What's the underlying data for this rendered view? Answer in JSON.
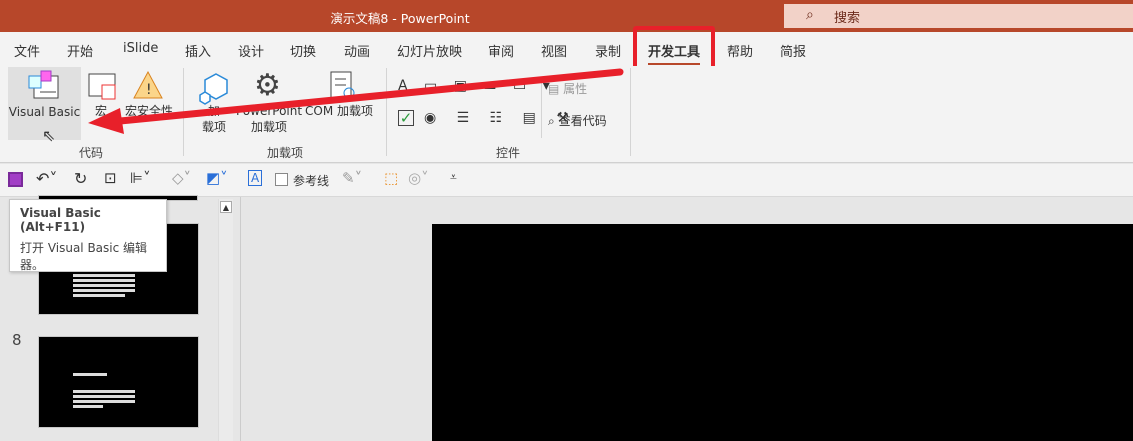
{
  "window": {
    "title": "演示文稿8  -  PowerPoint",
    "search_label": "搜索"
  },
  "tabs": [
    "文件",
    "开始",
    "iSlide",
    "插入",
    "设计",
    "切换",
    "动画",
    "幻灯片放映",
    "审阅",
    "视图",
    "录制",
    "开发工具",
    "帮助",
    "简报"
  ],
  "active_tab": "开发工具",
  "ribbon": {
    "code_group": {
      "label": "代码",
      "visual_basic": "Visual Basic",
      "macros": "宏",
      "macro_security": "宏安全性"
    },
    "addins_group": {
      "label": "加载项",
      "addins_1": "加",
      "addins_2": "载项",
      "ppt_addins_1": "PowerPoint",
      "ppt_addins_2": "加载项",
      "com_addins": "COM 加载项"
    },
    "controls_group": {
      "label": "控件",
      "properties": "属性",
      "view_code": "查看代码"
    }
  },
  "qat": {
    "guides": "参考线"
  },
  "tooltip": {
    "title": "Visual Basic (Alt+F11)",
    "body": "打开 Visual Basic 编辑器。"
  },
  "slides": [
    {
      "number": "8"
    }
  ],
  "colors": {
    "title_bar": "#b7472a",
    "highlight": "#e8202a"
  }
}
